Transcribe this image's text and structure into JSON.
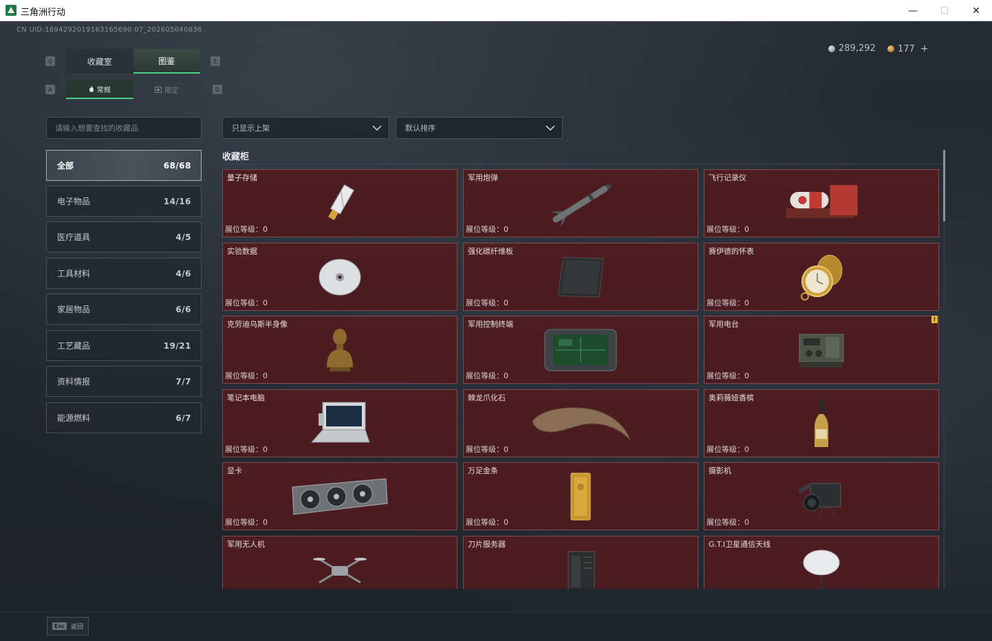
{
  "window": {
    "title": "三角洲行动",
    "minimize": "—",
    "maximize": "☐",
    "close": "✕"
  },
  "uid": "CN UID:1694292019163165690 07_202605040836",
  "currency": [
    {
      "icon": "silver-coin-icon",
      "value": "289,292"
    },
    {
      "icon": "gold-coin-icon",
      "value": "177",
      "plus": "+"
    }
  ],
  "keyhints": {
    "q": "Q",
    "e": "E",
    "a": "A",
    "d": "D"
  },
  "tabs": [
    {
      "label": "收藏室",
      "active": false
    },
    {
      "label": "图鉴",
      "active": true
    }
  ],
  "subtabs": [
    {
      "icon": "flame-icon",
      "label": "常规",
      "active": true
    },
    {
      "icon": "limited-icon",
      "label": "限定",
      "active": false
    }
  ],
  "search": {
    "placeholder": "请输入想要查找的收藏品"
  },
  "filters": {
    "shelf": "只显示上架",
    "sort": "默认排序"
  },
  "categories": [
    {
      "label": "全部",
      "count": "68/68",
      "active": true
    },
    {
      "label": "电子物品",
      "count": "14/16"
    },
    {
      "label": "医疗道具",
      "count": "4/5"
    },
    {
      "label": "工具材料",
      "count": "4/6"
    },
    {
      "label": "家居物品",
      "count": "6/6"
    },
    {
      "label": "工艺藏品",
      "count": "19/21"
    },
    {
      "label": "资料情报",
      "count": "7/7"
    },
    {
      "label": "能源燃料",
      "count": "6/7"
    }
  ],
  "section": {
    "title": "收藏柜"
  },
  "level_label": "展位等级：",
  "items": [
    {
      "name": "量子存储",
      "level": "0",
      "icon": "usb-drive-icon"
    },
    {
      "name": "军用炮弹",
      "level": "0",
      "icon": "missile-icon"
    },
    {
      "name": "飞行记录仪",
      "level": "0",
      "icon": "flight-recorder-icon"
    },
    {
      "name": "实验数据",
      "level": "0",
      "icon": "disc-icon"
    },
    {
      "name": "强化碳纤维板",
      "level": "0",
      "icon": "carbon-plate-icon"
    },
    {
      "name": "赛伊德的怀表",
      "level": "0",
      "icon": "pocket-watch-icon"
    },
    {
      "name": "克劳迪乌斯半身像",
      "level": "0",
      "icon": "bust-icon"
    },
    {
      "name": "军用控制终端",
      "level": "0",
      "icon": "control-terminal-icon"
    },
    {
      "name": "军用电台",
      "level": "0",
      "icon": "radio-icon"
    },
    {
      "name": "笔记本电脑",
      "level": "0",
      "icon": "laptop-icon"
    },
    {
      "name": "棘龙爪化石",
      "level": "0",
      "icon": "claw-fossil-icon"
    },
    {
      "name": "奥莉薇娅香槟",
      "level": "0",
      "icon": "champagne-icon"
    },
    {
      "name": "显卡",
      "level": "0",
      "icon": "graphics-card-icon"
    },
    {
      "name": "万足金条",
      "level": "0",
      "icon": "gold-bar-icon"
    },
    {
      "name": "摄影机",
      "level": "0",
      "icon": "camera-icon"
    },
    {
      "name": "军用无人机",
      "level": "",
      "icon": "drone-icon"
    },
    {
      "name": "刀片服务器",
      "level": "",
      "icon": "server-icon"
    },
    {
      "name": "G.T.I卫星通信天线",
      "level": "",
      "icon": "satellite-dish-icon"
    }
  ],
  "alert": "!",
  "bottom": {
    "esc_key": "Esc",
    "back_label": "返回"
  },
  "colors": {
    "accent": "#4fd08a",
    "card_bg": "#4e1d22",
    "card_border": "#7c4d52",
    "alert": "#e3b43a"
  }
}
